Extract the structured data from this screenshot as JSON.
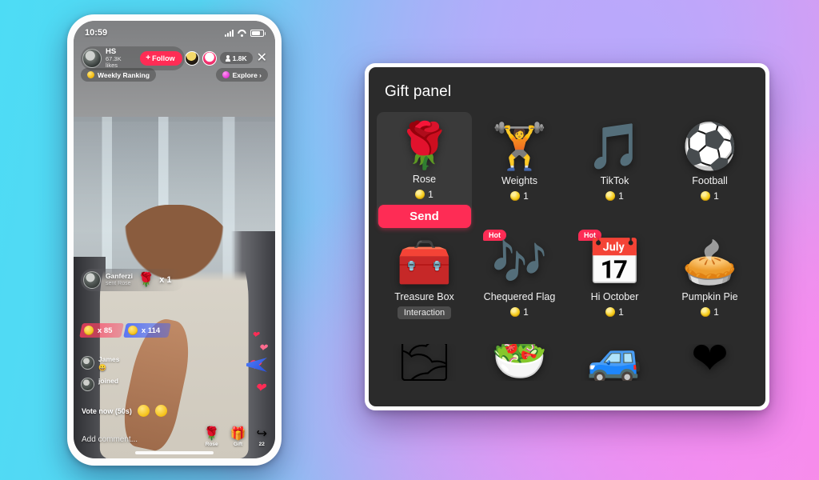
{
  "background": {
    "gradient_from": "#4ddcf5",
    "gradient_to": "#f98fe0"
  },
  "phone": {
    "status_bar": {
      "time": "10:59",
      "signal_icon": "signal-icon",
      "wifi_icon": "wifi-icon",
      "battery_icon": "battery-icon"
    },
    "live": {
      "host": {
        "name": "HS",
        "likes": "67.3K likes",
        "follow_label": "Follow",
        "plus": "+",
        "avatar": "host-avatar"
      },
      "viewers": {
        "count": "1.8K",
        "icon": "person-icon"
      },
      "close_label": "✕",
      "weekly_ranking": "Weekly Ranking",
      "explore": "Explore ›",
      "gift_float": {
        "name": "Ganferzi",
        "sub": "sent Rose",
        "multiplier": "x 1",
        "emoji": "🌹"
      },
      "vote_bars": [
        {
          "label": "x 85",
          "color": "#ff3c5f"
        },
        {
          "label": "x 114",
          "color": "#3c5fff"
        }
      ],
      "chat": [
        {
          "name": "James",
          "msg": "😀"
        },
        {
          "name": "joined",
          "msg": ""
        }
      ],
      "vote_now": "Vote now (50s)",
      "composer_placeholder": "Add comment...",
      "bottom_icons": [
        {
          "label": "Rose",
          "glyph": "🌹",
          "name": "rose-icon"
        },
        {
          "label": "Gift",
          "glyph": "🎁",
          "name": "gift-icon"
        },
        {
          "label": "22",
          "glyph": "↪",
          "name": "share-icon"
        }
      ]
    }
  },
  "gift_panel": {
    "title": "Gift panel",
    "send_label": "Send",
    "gifts": [
      {
        "name": "Rose",
        "emoji": "🌹",
        "cost": "1",
        "badge": "",
        "selected": true,
        "cut": false
      },
      {
        "name": "Weights",
        "emoji": "🏋",
        "cost": "1",
        "badge": "",
        "selected": false,
        "cut": false
      },
      {
        "name": "TikTok",
        "emoji": "🎵",
        "cost": "1",
        "badge": "",
        "selected": false,
        "cut": false
      },
      {
        "name": "Football",
        "emoji": "⚽",
        "cost": "1",
        "badge": "",
        "selected": false,
        "cut": false
      },
      {
        "name": "Treasure Box",
        "emoji": "🧰",
        "cost": "",
        "badge": "Interaction",
        "selected": false,
        "cut": false
      },
      {
        "name": "Chequered Flag",
        "emoji": "🎶",
        "cost": "1",
        "badge": "Hot",
        "selected": false,
        "cut": false
      },
      {
        "name": "Hi October",
        "emoji": "📅",
        "cost": "1",
        "badge": "Hot",
        "selected": false,
        "cut": false
      },
      {
        "name": "Pumpkin Pie",
        "emoji": "🥧",
        "cost": "1",
        "badge": "",
        "selected": false,
        "cut": false
      },
      {
        "name": "",
        "emoji": "🌫",
        "cost": "",
        "badge": "",
        "selected": false,
        "cut": true
      },
      {
        "name": "",
        "emoji": "🥗",
        "cost": "",
        "badge": "",
        "selected": false,
        "cut": true
      },
      {
        "name": "",
        "emoji": "🚙",
        "cost": "",
        "badge": "",
        "selected": false,
        "cut": true
      },
      {
        "name": "",
        "emoji": "❤",
        "cost": "",
        "badge": "",
        "selected": false,
        "cut": true
      }
    ]
  }
}
